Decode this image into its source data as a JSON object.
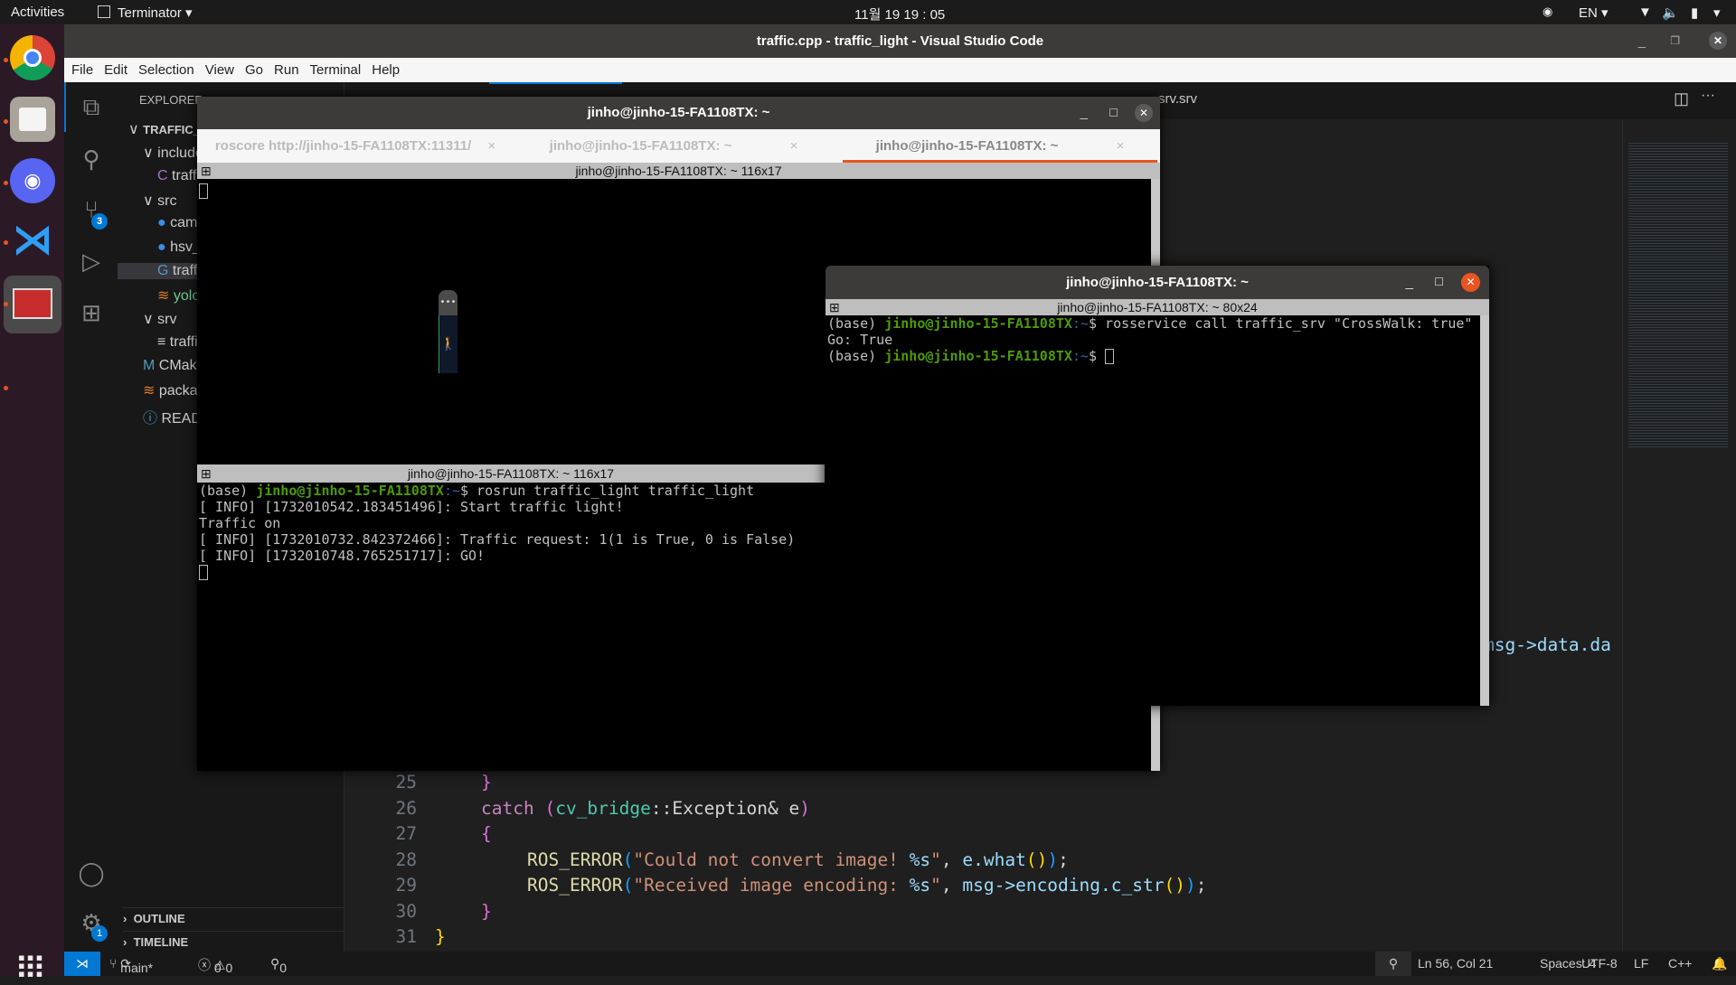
{
  "topbar": {
    "activities": "Activities",
    "app": "Terminator ▾",
    "clock": "11월 19  19 : 05",
    "lang": "EN ▾"
  },
  "dock": {
    "apps": [
      "Chrome",
      "Files",
      "Discord",
      "Visual Studio Code",
      "Terminator"
    ]
  },
  "vscode": {
    "title": "traffic.cpp - traffic_light - Visual Studio Code",
    "menu": [
      "File",
      "Edit",
      "Selection",
      "View",
      "Go",
      "Run",
      "Terminal",
      "Help"
    ],
    "explorer_title": "EXPLORER",
    "tree": [
      {
        "label": "TRAFFIC_L",
        "kind": "root"
      },
      {
        "label": "include",
        "kind": "folder"
      },
      {
        "label": "traffi",
        "kind": "c",
        "icon": "C"
      },
      {
        "label": "src",
        "kind": "folder"
      },
      {
        "label": "came",
        "kind": "python"
      },
      {
        "label": "hsv_f",
        "kind": "python"
      },
      {
        "label": "traffi",
        "kind": "cpp",
        "selected": true
      },
      {
        "label": "yolov",
        "kind": "rss"
      },
      {
        "label": "srv",
        "kind": "folder"
      },
      {
        "label": "traffi",
        "kind": "srv"
      },
      {
        "label": "CMake",
        "kind": "cmake"
      },
      {
        "label": "packag",
        "kind": "rss"
      },
      {
        "label": "READN",
        "kind": "info"
      }
    ],
    "outline": "OUTLINE",
    "timeline": "TIMELINE",
    "source_control_badge": "3",
    "settings_badge": "1",
    "visible_tab": "srv.srv",
    "partial_code": "msg->data.da",
    "code": [
      {
        "n": "25",
        "indent": 1,
        "parts": [
          [
            "}",
            "#da70d6"
          ]
        ]
      },
      {
        "n": "26",
        "indent": 1,
        "parts": [
          [
            "catch ",
            "#c586c0"
          ],
          [
            "(",
            "#da70d6"
          ],
          [
            "cv_bridge",
            "#4ec9b0"
          ],
          [
            "::Exception& e",
            "#d4d4d4"
          ],
          [
            ")",
            "#da70d6"
          ]
        ]
      },
      {
        "n": "27",
        "indent": 1,
        "parts": [
          [
            "{",
            "#da70d6"
          ]
        ]
      },
      {
        "n": "28",
        "indent": 2,
        "parts": [
          [
            "ROS_ERROR",
            "#dcdcaa"
          ],
          [
            "(",
            "#179fff"
          ],
          [
            "\"Could not convert image! ",
            "#ce9178"
          ],
          [
            "%s",
            "#9cdcfe"
          ],
          [
            "\"",
            "#ce9178"
          ],
          [
            ", ",
            "#d4d4d4"
          ],
          [
            "e.what",
            "#9cdcfe"
          ],
          [
            "()",
            "#ffd700"
          ],
          [
            ")",
            "#179fff"
          ],
          [
            ";",
            "#d4d4d4"
          ]
        ]
      },
      {
        "n": "29",
        "indent": 2,
        "parts": [
          [
            "ROS_ERROR",
            "#dcdcaa"
          ],
          [
            "(",
            "#179fff"
          ],
          [
            "\"Received image encoding: ",
            "#ce9178"
          ],
          [
            "%s",
            "#9cdcfe"
          ],
          [
            "\"",
            "#ce9178"
          ],
          [
            ", ",
            "#d4d4d4"
          ],
          [
            "msg->encoding.c_str",
            "#9cdcfe"
          ],
          [
            "()",
            "#ffd700"
          ],
          [
            ")",
            "#179fff"
          ],
          [
            ";",
            "#d4d4d4"
          ]
        ]
      },
      {
        "n": "30",
        "indent": 1,
        "parts": [
          [
            "}",
            "#da70d6"
          ]
        ]
      },
      {
        "n": "31",
        "indent": 0,
        "parts": [
          [
            "}",
            "#ffd700"
          ]
        ]
      }
    ],
    "status": {
      "branch": "main*",
      "errors": "0",
      "warnings": "0",
      "ports": "0",
      "position": "Ln 56, Col 21",
      "spaces": "Spaces: 4",
      "encoding": "UTF-8",
      "eol": "LF",
      "language": "C++"
    }
  },
  "terminator_main": {
    "title": "jinho@jinho-15-FA1108TX: ~",
    "tabs": [
      {
        "label": "roscore http://jinho-15-FA1108TX:11311/",
        "active": false
      },
      {
        "label": "jinho@jinho-15-FA1108TX: ~",
        "active": false
      },
      {
        "label": "jinho@jinho-15-FA1108TX: ~",
        "active": true
      }
    ],
    "pane1_header": "jinho@jinho-15-FA1108TX: ~ 116x17",
    "pane2_header": "jinho@jinho-15-FA1108TX: ~ 116x17",
    "pane2": {
      "prefix": "(base) ",
      "user": "jinho@jinho-15-FA1108TX",
      "path": ":~",
      "cmd": "$ rosrun traffic_light traffic_light",
      "output": [
        "[ INFO] [1732010542.183451496]: Start traffic light!",
        "Traffic on",
        "[ INFO] [1732010732.842372466]: Traffic request: 1(1 is True, 0 is False)",
        "[ INFO] [1732010748.765251717]: GO!"
      ]
    }
  },
  "terminator_float": {
    "title": "jinho@jinho-15-FA1108TX: ~",
    "pane_header": "jinho@jinho-15-FA1108TX: ~ 80x24",
    "prefix": "(base) ",
    "user": "jinho@jinho-15-FA1108TX",
    "path": ":~",
    "cmd": "$ rosservice call traffic_srv \"CrossWalk: true\"",
    "output": "Go: True",
    "prompt2": "$ "
  },
  "colors": {
    "accent_orange": "#e95420",
    "vscode_blue": "#0078d4",
    "prompt_green": "#4e9a06"
  }
}
